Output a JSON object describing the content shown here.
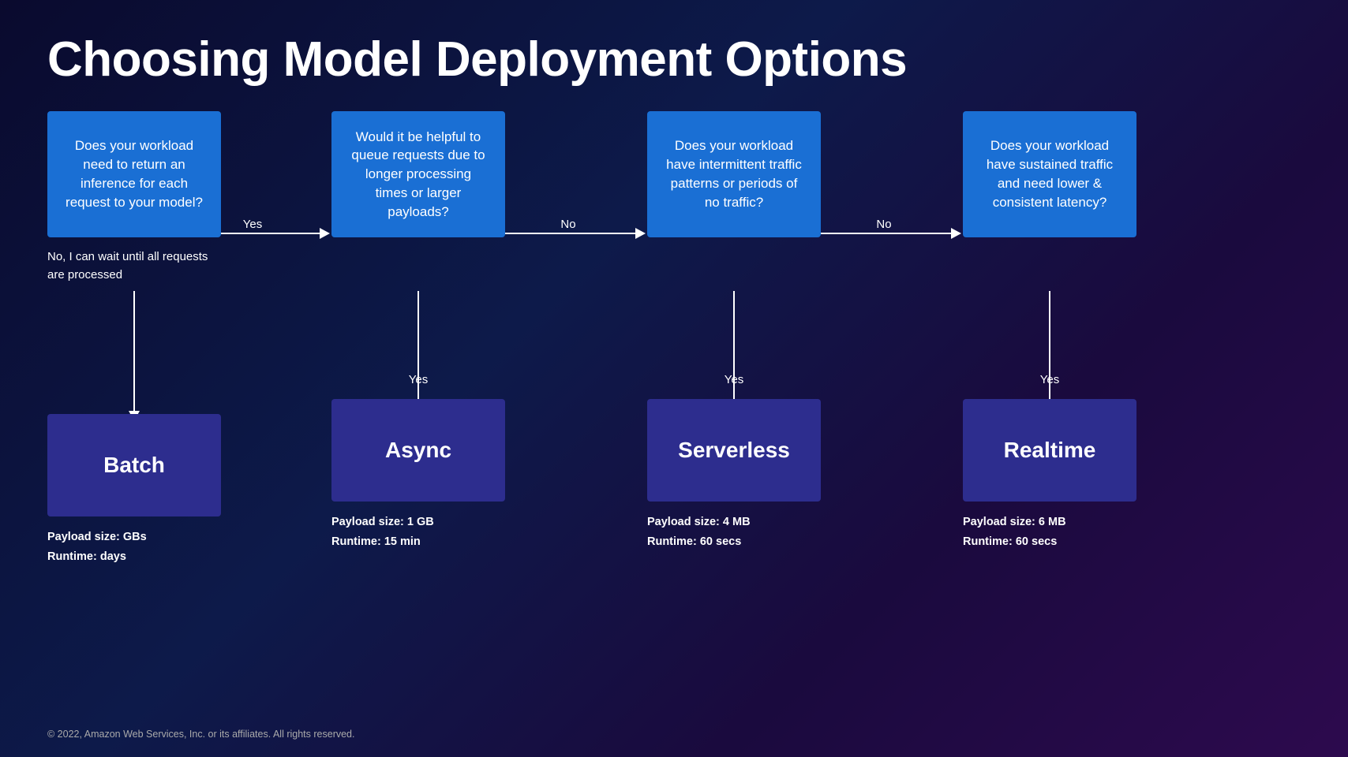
{
  "title": "Choosing Model Deployment Options",
  "columns": [
    {
      "id": "col1",
      "decision_text": "Does your workload need to return an inference for each request to your model?",
      "no_label": "No, I can wait until all requests are processed",
      "yes_label": "Yes",
      "result_name": "Batch",
      "payload": "Payload size: GBs",
      "runtime": "Runtime: days",
      "arrow_direction": "down",
      "arrow_side_label": "No"
    },
    {
      "id": "col2",
      "decision_text": "Would it be helpful to queue requests due to longer processing times or larger payloads?",
      "yes_label": "Yes",
      "result_name": "Async",
      "payload": "Payload size: 1 GB",
      "runtime": "Runtime: 15 min",
      "arrow_direction": "down",
      "h_label": "No"
    },
    {
      "id": "col3",
      "decision_text": "Does your workload have intermittent traffic patterns or periods of no traffic?",
      "yes_label": "Yes",
      "result_name": "Serverless",
      "payload": "Payload size: 4 MB",
      "runtime": "Runtime: 60 secs",
      "arrow_direction": "down",
      "h_label": "No"
    },
    {
      "id": "col4",
      "decision_text": "Does your workload have sustained traffic and need lower & consistent latency?",
      "yes_label": "Yes",
      "result_name": "Realtime",
      "payload": "Payload size: 6 MB",
      "runtime": "Runtime: 60 secs",
      "arrow_direction": "down"
    }
  ],
  "footer": "© 2022, Amazon Web Services, Inc. or its affiliates. All rights reserved.",
  "colors": {
    "decision_box_bg": "#1a6fd4",
    "result_box_bg": "#2d2d8e",
    "arrow_color": "white",
    "background_start": "#0a0a2e",
    "background_end": "#2d0a4e"
  }
}
